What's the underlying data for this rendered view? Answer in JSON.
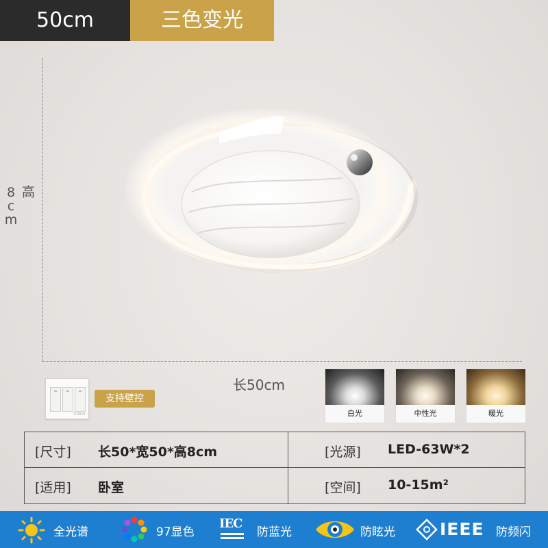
{
  "banner": {
    "size": "50cm",
    "light_mode": "三色变光"
  },
  "dimensions": {
    "height_label": "高8cm",
    "length_label": "长50cm"
  },
  "switch": {
    "brand": "TORCH",
    "wall_control_label": "支持壁控"
  },
  "light_tiles": [
    {
      "label": "白光"
    },
    {
      "label": "中性光"
    },
    {
      "label": "暖光"
    }
  ],
  "specs": {
    "size_key": "[尺寸]",
    "size_value": "长50*宽50*高8cm",
    "source_key": "[光源]",
    "source_value": "LED-63W*2",
    "use_key": "[适用]",
    "use_value": "卧室",
    "space_key": "[空间]",
    "space_value": "10-15m²"
  },
  "features": {
    "full_spectrum": "全光谱",
    "cri": "97显色",
    "iec_mark": "IEC",
    "anti_blue": "防蓝光",
    "anti_glare": "防眩光",
    "ieee_mark": "IEEE",
    "anti_flicker": "防频闪"
  },
  "colors": {
    "banner_dark": "#2b2b2b",
    "accent_gold": "#c9a24a",
    "feature_bar": "#1e7fd0",
    "sun": "#f5c518"
  }
}
